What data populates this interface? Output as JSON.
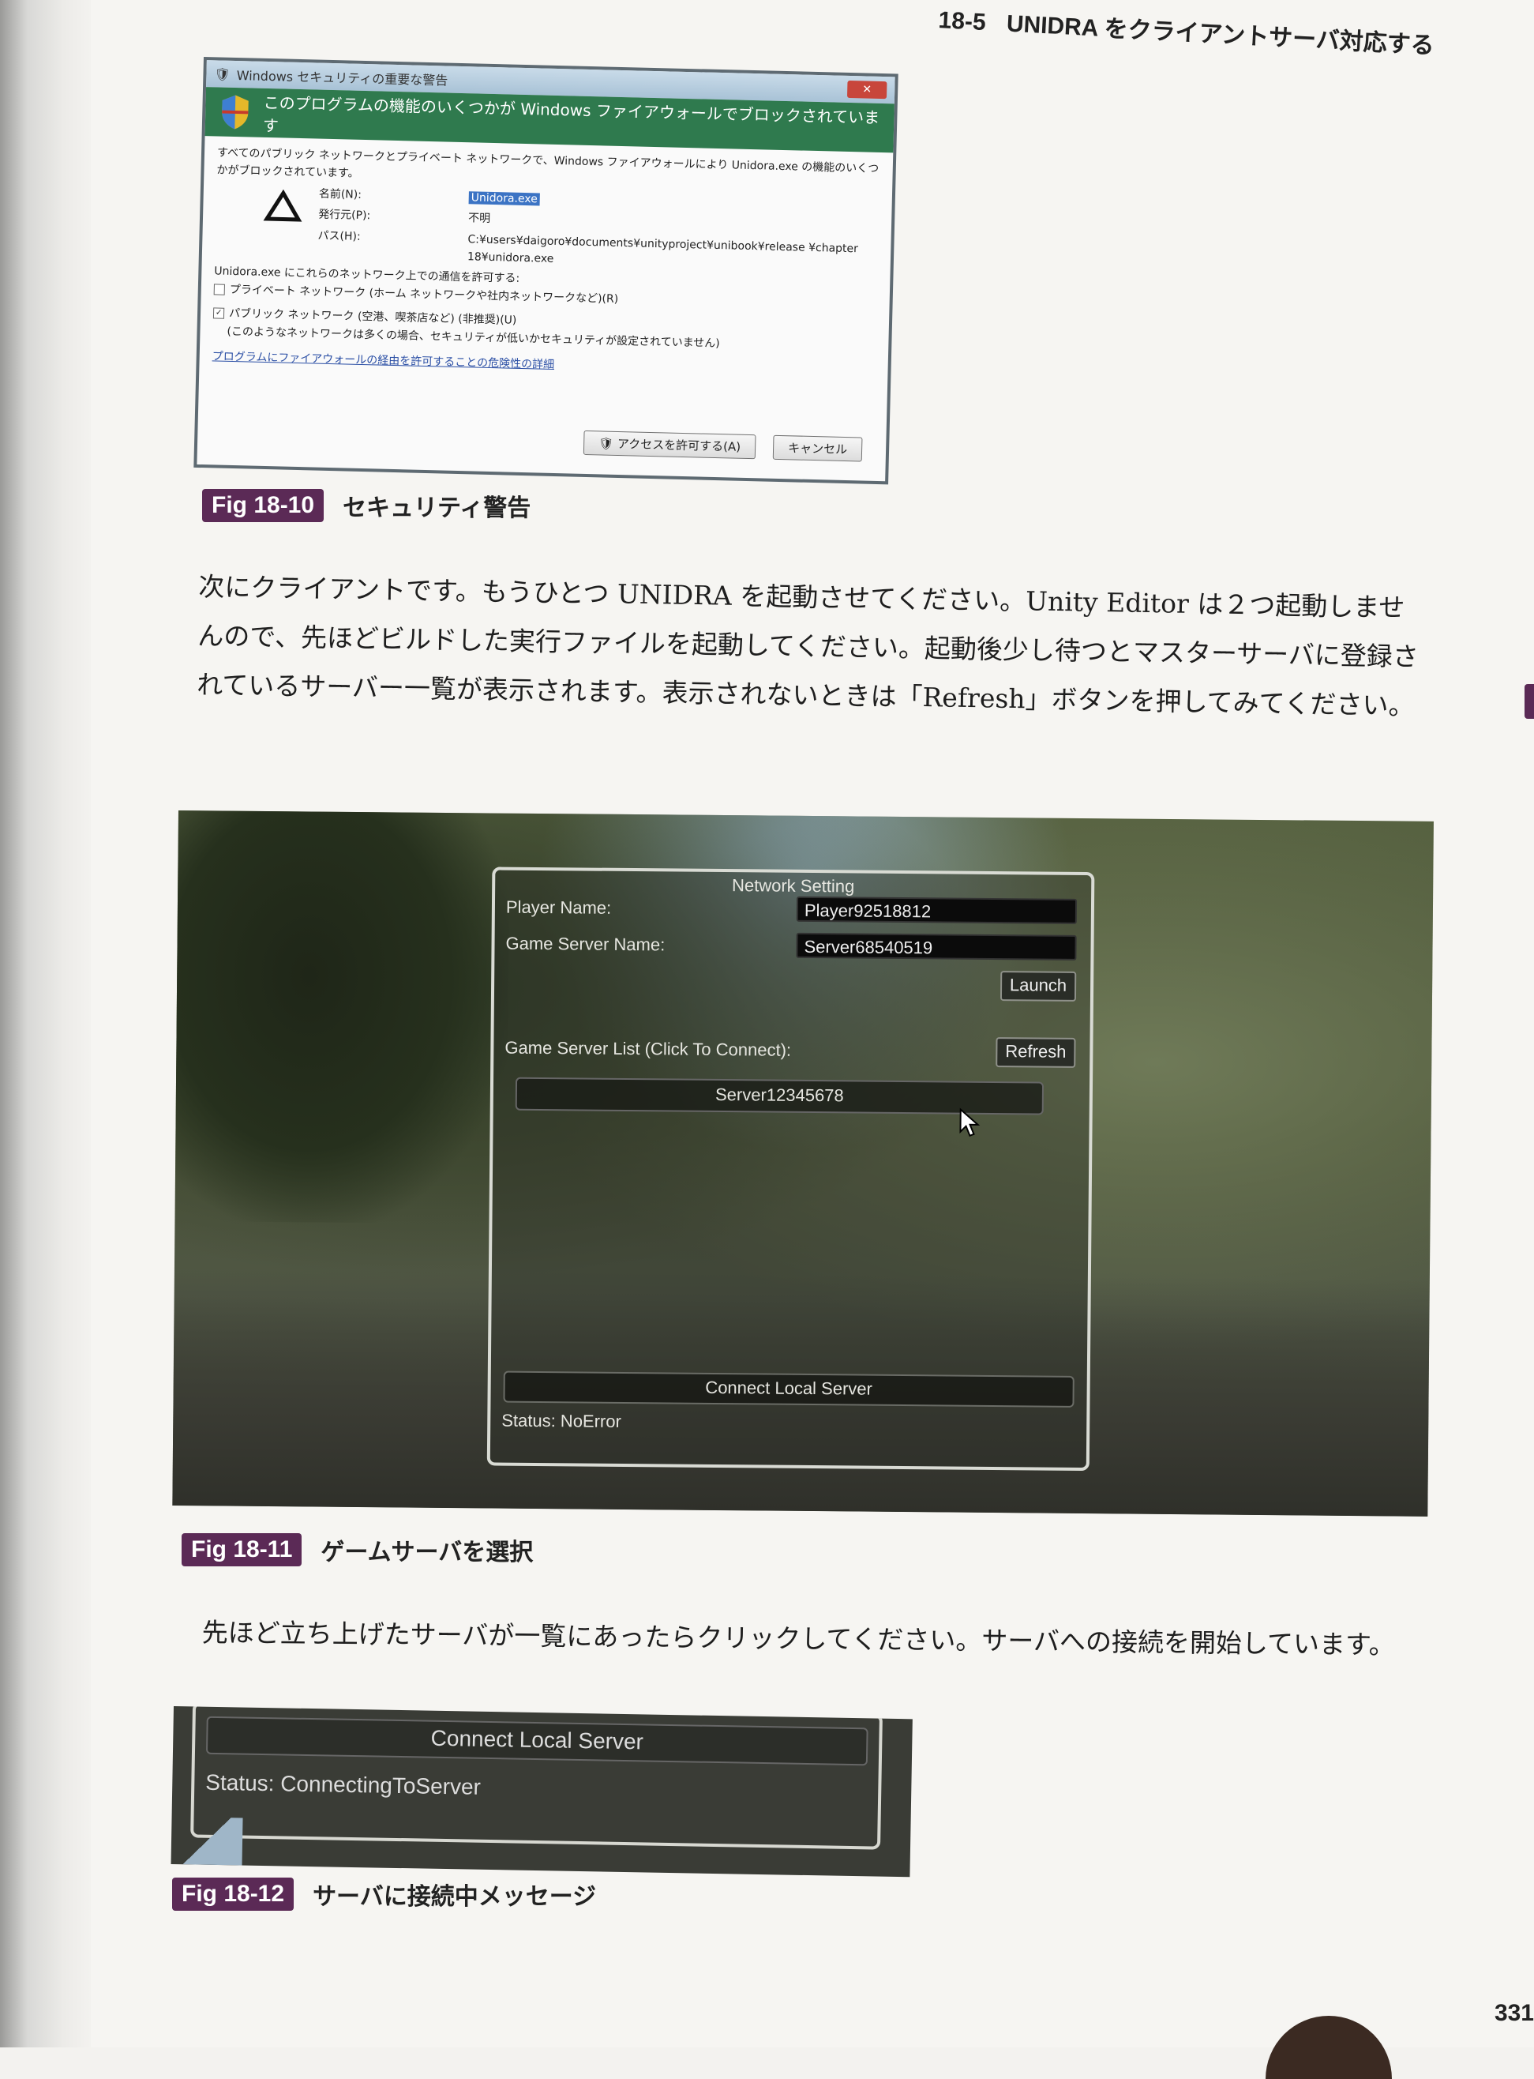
{
  "running_head": {
    "section": "18-5",
    "title": "UNIDRA をクライアントサーバ対応する"
  },
  "fig_18_10": {
    "label": "Fig 18-10",
    "caption": "セキュリティ警告",
    "dialog": {
      "window_title": "Windows セキュリティの重要な警告",
      "banner": "このプログラムの機能のいくつかが Windows ファイアウォールでブロックされています",
      "intro": "すべてのパブリック ネットワークとプライベート ネットワークで、Windows ファイアウォールにより Unidora.exe の機能のいくつかがブロックされています。",
      "name_label": "名前(N):",
      "name_value": "Unidora.exe",
      "publisher_label": "発行元(P):",
      "publisher_value": "不明",
      "path_label": "パス(H):",
      "path_value": "C:¥users¥daigoro¥documents¥unityproject¥unibook¥release ¥chapter 18¥unidora.exe",
      "allow_text": "Unidora.exe にこれらのネットワーク上での通信を許可する:",
      "private_network": "プライベート ネットワーク (ホーム ネットワークや社内ネットワークなど)(R)",
      "public_network": "パブリック ネットワーク (空港、喫茶店など) (非推奨)(U)",
      "public_network_note": "(このようなネットワークは多くの場合、セキュリティが低いかセキュリティが設定されていません)",
      "risk_link": "プログラムにファイアウォールの経由を許可することの危険性の詳細",
      "allow_button": "アクセスを許可する(A)",
      "cancel_button": "キャンセル"
    }
  },
  "paragraph_1": "次にクライアントです。もうひとつ UNIDRA を起動させてください。Unity Editor は２つ起動しませんので、先ほどビルドした実行ファイルを起動してください。起動後少し待つとマスターサーバに登録されているサーバー一覧が表示されます。表示されないときは「Refresh」ボタンを押してみてください。",
  "fig_18_11": {
    "label": "Fig 18-11",
    "caption": "ゲームサーバを選択",
    "panel": {
      "title": "Network Setting",
      "player_name_label": "Player Name:",
      "player_name_value": "Player92518812",
      "game_server_name_label": "Game Server Name:",
      "game_server_name_value": "Server68540519",
      "launch_button": "Launch",
      "server_list_label": "Game Server List (Click To Connect):",
      "refresh_button": "Refresh",
      "server_item": "Server12345678",
      "connect_local_button": "Connect Local Server",
      "status": "Status: NoError"
    }
  },
  "paragraph_2": "先ほど立ち上げたサーバが一覧にあったらクリックしてください。サーバへの接続を開始しています。",
  "fig_18_12": {
    "label": "Fig 18-12",
    "caption": "サーバに接続中メッセージ",
    "connect_local_button": "Connect Local Server",
    "status": "Status: ConnectingToServer"
  },
  "page_number": "331"
}
